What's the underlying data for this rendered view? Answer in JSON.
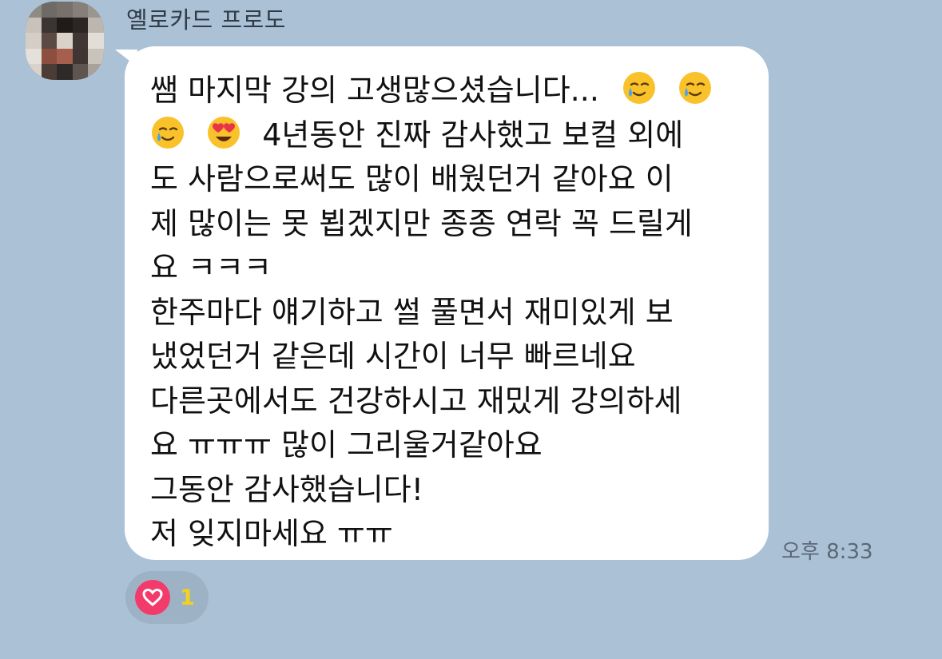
{
  "sender": {
    "name": "옐로카드 프로도"
  },
  "message": {
    "lines": [
      "쌤 마지막 강의 고생많으셨습니다...",
      "4년동안 진짜 감사했고 보컬 외에",
      "도 사람으로써도 많이 배웠던거 같아요 이",
      "제 많이는 못 뵙겠지만 종종 연락 꼭 드릴게",
      "요 ㅋㅋㅋ",
      "한주마다 얘기하고 썰 풀면서 재미있게 보",
      "냈었던거 같은데 시간이 너무 빠르네요",
      "다른곳에서도 건강하시고 재밌게 강의하세",
      "요 ㅠㅠㅠ 많이 그리울거같아요",
      "그동안 감사했습니다!",
      "저 잊지마세요 ㅠㅠ"
    ],
    "emojis": [
      "smiling-face-with-tear",
      "smiling-face-with-tear",
      "smiling-face-with-tear",
      "heart-eyes"
    ]
  },
  "timestamp": "오후 8:33",
  "reaction": {
    "icon": "heart-icon",
    "count": "1",
    "count_color": "#f3d21b",
    "heart_color": "#f23a6b"
  },
  "colors": {
    "background": "#abc1d6",
    "bubble": "#ffffff"
  }
}
